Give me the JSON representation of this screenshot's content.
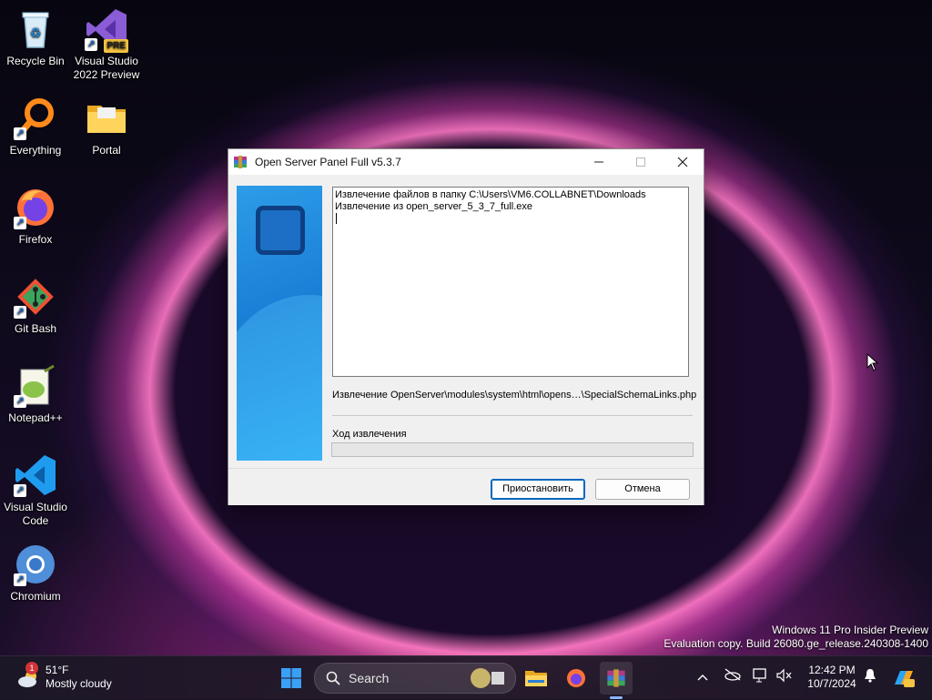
{
  "desktop": {
    "icons": [
      {
        "label": "Recycle Bin",
        "icon": "recycle-bin-icon"
      },
      {
        "label": "Visual Studio 2022 Preview",
        "icon": "visual-studio-icon",
        "badge": "PRE"
      },
      {
        "label": "Everything",
        "icon": "everything-search-icon"
      },
      {
        "label": "Portal",
        "icon": "folder-icon"
      },
      {
        "label": "Firefox",
        "icon": "firefox-icon"
      },
      {
        "label": "Git Bash",
        "icon": "git-bash-icon"
      },
      {
        "label": "Notepad++",
        "icon": "notepadpp-icon"
      },
      {
        "label": "Visual Studio Code",
        "icon": "vscode-icon"
      },
      {
        "label": "Chromium",
        "icon": "chromium-icon"
      }
    ]
  },
  "dialog": {
    "title": "Open Server Panel Full v5.3.7",
    "log_lines": [
      "Извлечение файлов в папку C:\\Users\\VM6.COLLABNET\\Downloads",
      "Извлечение из open_server_5_3_7_full.exe"
    ],
    "current_file": "Извлечение OpenServer\\modules\\system\\html\\opens…\\SpecialSchemaLinks.php",
    "progress_label": "Ход извлечения",
    "progress_value": 0,
    "pause_button": "Приостановить",
    "cancel_button": "Отмена"
  },
  "watermark": {
    "line1": "Windows 11 Pro Insider Preview",
    "line2": "Evaluation copy. Build 26080.ge_release.240308-1400"
  },
  "taskbar": {
    "weather_temp": "51°F",
    "weather_desc": "Mostly cloudy",
    "weather_badge": "1",
    "search_placeholder": "Search",
    "time": "12:42 PM",
    "date": "10/7/2024"
  },
  "colors": {
    "accent": "#0067c0",
    "taskbar": "#1c1826",
    "banner_blue": "#1a7fd6"
  }
}
